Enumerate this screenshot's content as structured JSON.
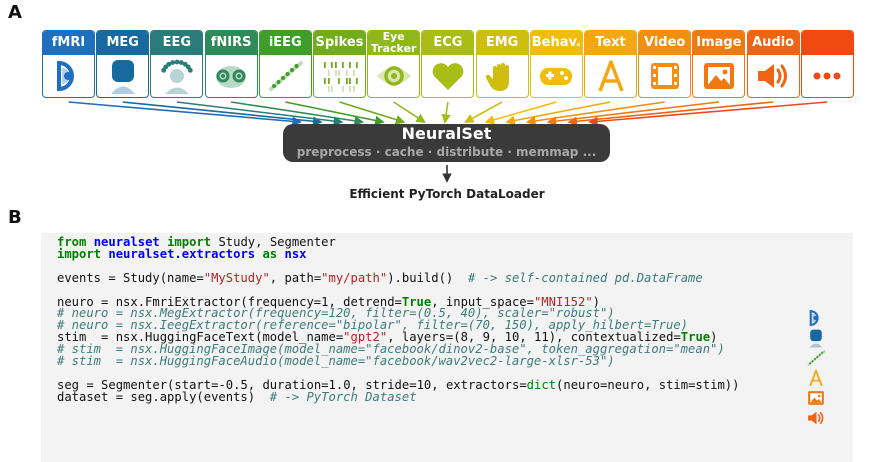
{
  "panels": {
    "a": "A",
    "b": "B"
  },
  "modalities": [
    {
      "label": "fMRI",
      "color": "#1f6fc0",
      "icon": "fmri-icon"
    },
    {
      "label": "MEG",
      "color": "#176a9e",
      "icon": "meg-head-icon"
    },
    {
      "label": "EEG",
      "color": "#2b7b7b",
      "icon": "eeg-head-icon"
    },
    {
      "label": "fNIRS",
      "color": "#2f8a5a",
      "icon": "fnirs-head-icon"
    },
    {
      "label": "iEEG",
      "color": "#3f9e2a",
      "icon": "ieeg-probe-icon"
    },
    {
      "label": "Spikes",
      "color": "#72ac1a",
      "icon": "spike-raster-icon"
    },
    {
      "label": "Eye\nTracker",
      "color": "#91b81b",
      "icon": "eye-icon"
    },
    {
      "label": "ECG",
      "color": "#a9bd16",
      "icon": "heart-icon"
    },
    {
      "label": "EMG",
      "color": "#cfbe10",
      "icon": "hand-icon"
    },
    {
      "label": "Behav.",
      "color": "#f0bd0e",
      "icon": "gamepad-icon"
    },
    {
      "label": "Text",
      "color": "#f3a813",
      "icon": "text-a-icon"
    },
    {
      "label": "Video",
      "color": "#f18f10",
      "icon": "film-icon"
    },
    {
      "label": "Image",
      "color": "#f07a12",
      "icon": "image-icon"
    },
    {
      "label": "Audio",
      "color": "#ee6414",
      "icon": "speaker-icon"
    },
    {
      "label": "",
      "color": "#f04a10",
      "icon": "more-dots-icon"
    }
  ],
  "neuralset": {
    "title": "NeuralSet",
    "subtitle": "preprocess · cache · distribute · memmap ..."
  },
  "output_label": "Efficient PyTorch DataLoader",
  "code": {
    "lines": [
      [
        {
          "t": "kw",
          "v": "from"
        },
        {
          "t": "",
          "v": " "
        },
        {
          "t": "mod",
          "v": "neuralset"
        },
        {
          "t": "",
          "v": " "
        },
        {
          "t": "kw",
          "v": "import"
        },
        {
          "t": "",
          "v": " Study, Segmenter"
        }
      ],
      [
        {
          "t": "kw",
          "v": "import"
        },
        {
          "t": "",
          "v": " "
        },
        {
          "t": "mod",
          "v": "neuralset.extractors"
        },
        {
          "t": "",
          "v": " "
        },
        {
          "t": "kw",
          "v": "as"
        },
        {
          "t": "",
          "v": " "
        },
        {
          "t": "mod",
          "v": "nsx"
        }
      ],
      [],
      [
        {
          "t": "",
          "v": "events = Study(name="
        },
        {
          "t": "str",
          "v": "\"MyStudy\""
        },
        {
          "t": "",
          "v": ", path="
        },
        {
          "t": "str",
          "v": "\"my/path\""
        },
        {
          "t": "",
          "v": ").build()  "
        },
        {
          "t": "com",
          "v": "# -> self-contained pd.DataFrame"
        }
      ],
      [],
      [
        {
          "t": "",
          "v": "neuro = nsx.FmriExtractor(frequency="
        },
        {
          "t": "num",
          "v": "1"
        },
        {
          "t": "",
          "v": ", detrend="
        },
        {
          "t": "kw",
          "v": "True"
        },
        {
          "t": "",
          "v": ", input_space="
        },
        {
          "t": "str",
          "v": "\"MNI152\""
        },
        {
          "t": "",
          "v": ")"
        }
      ],
      [
        {
          "t": "com",
          "v": "# neuro = nsx.MegExtractor(frequency=120, filter=(0.5, 40), scaler=\"robust\")"
        }
      ],
      [
        {
          "t": "com",
          "v": "# neuro = nsx.IeegExtractor(reference=\"bipolar\", filter=(70, 150), apply_hilbert=True)"
        }
      ],
      [
        {
          "t": "",
          "v": "stim  = nsx.HuggingFaceText(model_name="
        },
        {
          "t": "str",
          "v": "\"gpt2\""
        },
        {
          "t": "",
          "v": ", layers=("
        },
        {
          "t": "num",
          "v": "8"
        },
        {
          "t": "",
          "v": ", "
        },
        {
          "t": "num",
          "v": "9"
        },
        {
          "t": "",
          "v": ", "
        },
        {
          "t": "num",
          "v": "10"
        },
        {
          "t": "",
          "v": ", "
        },
        {
          "t": "num",
          "v": "11"
        },
        {
          "t": "",
          "v": "), contextualized="
        },
        {
          "t": "kw",
          "v": "True"
        },
        {
          "t": "",
          "v": ")"
        }
      ],
      [
        {
          "t": "com",
          "v": "# stim  = nsx.HuggingFaceImage(model_name=\"facebook/dinov2-base\", token_aggregation=\"mean\")"
        }
      ],
      [
        {
          "t": "com",
          "v": "# stim  = nsx.HuggingFaceAudio(model_name=\"facebook/wav2vec2-large-xlsr-53\")"
        }
      ],
      [],
      [
        {
          "t": "",
          "v": "seg = Segmenter(start="
        },
        {
          "t": "num",
          "v": "-0.5"
        },
        {
          "t": "",
          "v": ", duration="
        },
        {
          "t": "num",
          "v": "1.0"
        },
        {
          "t": "",
          "v": ", stride="
        },
        {
          "t": "num",
          "v": "10"
        },
        {
          "t": "",
          "v": ", extractors="
        },
        {
          "t": "bi",
          "v": "dict"
        },
        {
          "t": "",
          "v": "(neuro=neuro, stim=stim))"
        }
      ],
      [
        {
          "t": "",
          "v": "dataset = seg.apply(events)  "
        },
        {
          "t": "com",
          "v": "# -> PyTorch Dataset"
        }
      ]
    ]
  },
  "side_icons": [
    "fmri-icon",
    "meg-head-icon",
    "ieeg-probe-icon",
    "text-a-icon",
    "image-icon",
    "speaker-icon"
  ],
  "colors": {
    "box": "#3a3a3a",
    "box_sub": "#a8a8a8",
    "code_bg": "#f3f3f3"
  }
}
